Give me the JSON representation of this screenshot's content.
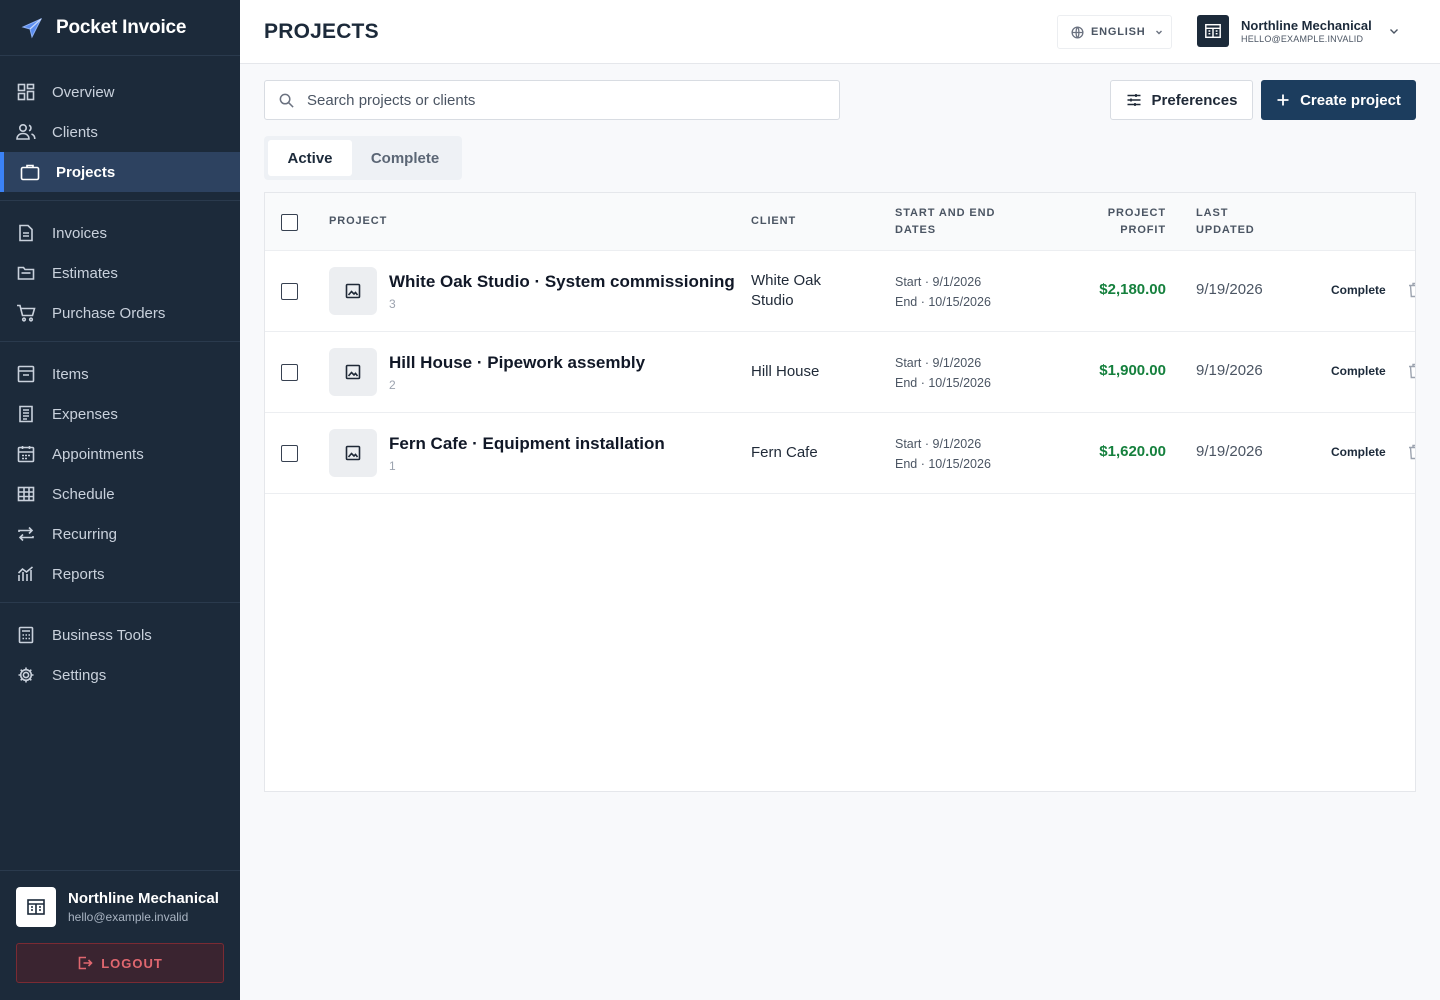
{
  "app": {
    "name": "Pocket Invoice",
    "logo_icon": "paper-plane-icon"
  },
  "sidebar": {
    "groups": [
      [
        {
          "label": "Overview",
          "icon": "grid-icon"
        },
        {
          "label": "Clients",
          "icon": "users-icon"
        },
        {
          "label": "Projects",
          "icon": "briefcase-icon",
          "active": true
        }
      ],
      [
        {
          "label": "Invoices",
          "icon": "document-icon"
        },
        {
          "label": "Estimates",
          "icon": "folder-icon"
        },
        {
          "label": "Purchase Orders",
          "icon": "cart-icon"
        }
      ],
      [
        {
          "label": "Items",
          "icon": "box-icon"
        },
        {
          "label": "Expenses",
          "icon": "receipt-icon"
        },
        {
          "label": "Appointments",
          "icon": "calendar-icon"
        },
        {
          "label": "Schedule",
          "icon": "table-icon"
        },
        {
          "label": "Recurring",
          "icon": "repeat-icon"
        },
        {
          "label": "Reports",
          "icon": "chart-icon"
        }
      ],
      [
        {
          "label": "Business Tools",
          "icon": "calculator-icon"
        },
        {
          "label": "Settings",
          "icon": "gear-icon"
        }
      ]
    ],
    "account": {
      "name": "Northline Mechanical",
      "email": "hello@example.invalid"
    },
    "logout_label": "LOGOUT"
  },
  "header": {
    "title": "PROJECTS",
    "language": "ENGLISH",
    "user_name": "Northline Mechanical",
    "user_email": "HELLO@EXAMPLE.INVALID"
  },
  "toolbar": {
    "search_placeholder": "Search projects or clients",
    "preferences_label": "Preferences",
    "create_label": "Create project"
  },
  "tabs": [
    {
      "label": "Active",
      "active": true
    },
    {
      "label": "Complete",
      "active": false
    }
  ],
  "table": {
    "columns": {
      "project": "PROJECT",
      "client": "CLIENT",
      "dates_1": "START AND END",
      "dates_2": "DATES",
      "profit_1": "PROJECT",
      "profit_2": "PROFIT",
      "updated_1": "LAST",
      "updated_2": "UPDATED"
    },
    "rows": [
      {
        "name": "White Oak Studio · System commissioning",
        "number": "3",
        "client_1": "White Oak",
        "client_2": "Studio",
        "start": "Start · 9/1/2026",
        "end": "End · 10/15/2026",
        "profit": "$2,180.00",
        "updated": "9/19/2026",
        "action": "Complete"
      },
      {
        "name": "Hill House · Pipework assembly",
        "number": "2",
        "client_1": "Hill House",
        "client_2": "",
        "start": "Start · 9/1/2026",
        "end": "End · 10/15/2026",
        "profit": "$1,900.00",
        "updated": "9/19/2026",
        "action": "Complete"
      },
      {
        "name": "Fern Cafe · Equipment installation",
        "number": "1",
        "client_1": "Fern Cafe",
        "client_2": "",
        "start": "Start · 9/1/2026",
        "end": "End · 10/15/2026",
        "profit": "$1,620.00",
        "updated": "9/19/2026",
        "action": "Complete"
      }
    ]
  },
  "colors": {
    "sidebar_bg": "#1c2a3a",
    "active_item_bg": "#2d4260",
    "accent": "#3b82f6",
    "primary_button": "#1c3d5e",
    "profit_green": "#15803d",
    "logout_red": "#e0676f"
  }
}
